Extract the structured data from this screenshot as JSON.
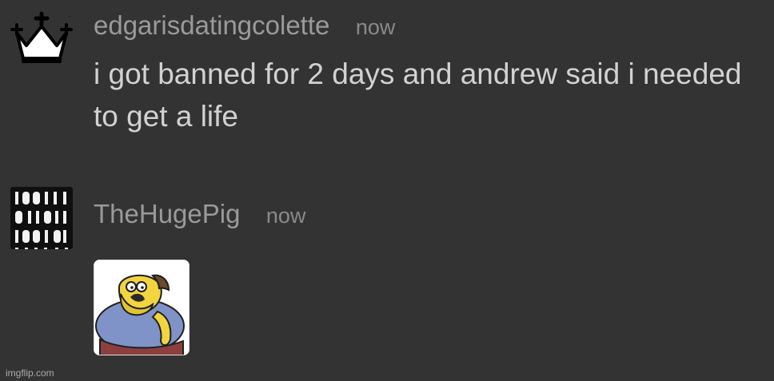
{
  "messages": [
    {
      "avatar_icon": "crown-icon",
      "username": "edgarisdatingcolette",
      "timestamp": "now",
      "text": "i got banned for 2 days and andrew said i needed to get a life"
    },
    {
      "avatar_icon": "binary-code-icon",
      "username": "TheHugePig",
      "timestamp": "now",
      "attachment_icon": "comic-book-guy-image"
    }
  ],
  "watermark": "imgflip.com",
  "colors": {
    "background": "#333333",
    "username": "#9a9a9a",
    "timestamp": "#8a8a8a",
    "message_text": "#d2d2d2"
  }
}
